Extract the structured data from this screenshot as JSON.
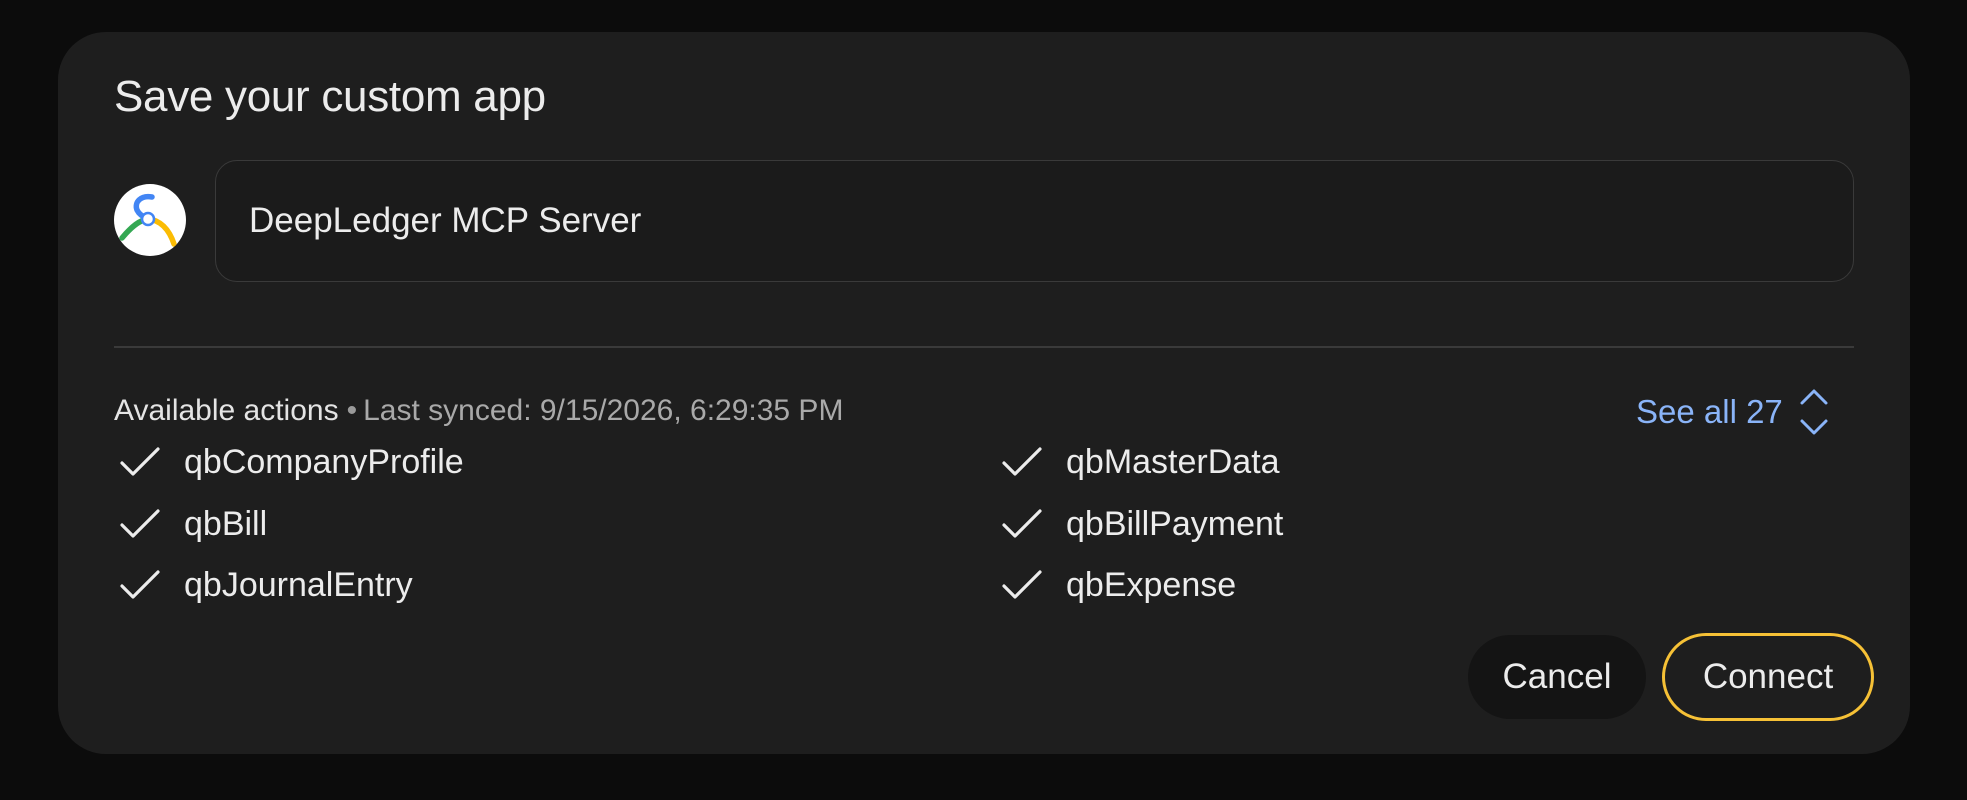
{
  "dialog": {
    "title": "Save your custom app"
  },
  "app": {
    "icon": "custom-app-logo",
    "name_value": "DeepLedger MCP Server"
  },
  "actions": {
    "header_label": "Available actions",
    "separator": "•",
    "last_synced": "Last synced: 9/15/2026, 6:29:35 PM",
    "see_all_label": "See all 27",
    "see_all_icon": "expand-collapse-chevrons-icon",
    "items": [
      {
        "label": "qbCompanyProfile",
        "checked": true
      },
      {
        "label": "qbMasterData",
        "checked": true
      },
      {
        "label": "qbBill",
        "checked": true
      },
      {
        "label": "qbBillPayment",
        "checked": true
      },
      {
        "label": "qbJournalEntry",
        "checked": true
      },
      {
        "label": "qbExpense",
        "checked": true
      }
    ]
  },
  "buttons": {
    "cancel_label": "Cancel",
    "connect_label": "Connect"
  },
  "colors": {
    "dialog_background": "#1e1e1e",
    "link_accent": "#8ab4f8",
    "connect_border": "#f6c136",
    "logo_blue": "#4285f4",
    "logo_green": "#34a853",
    "logo_yellow": "#fbbc04"
  }
}
